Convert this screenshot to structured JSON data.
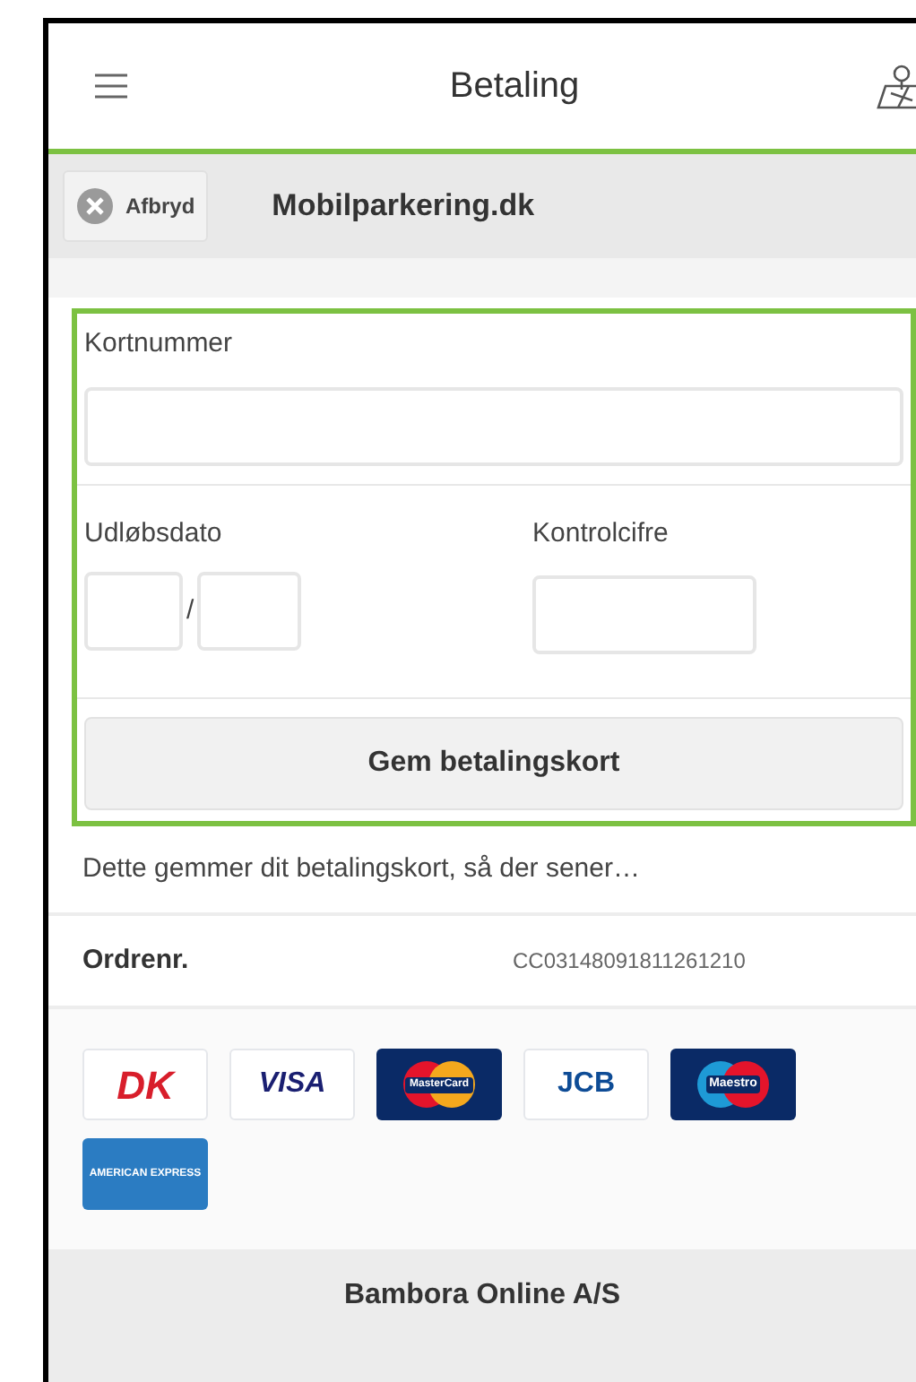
{
  "header": {
    "title": "Betaling"
  },
  "toolbar": {
    "cancel_label": "Afbryd",
    "merchant": "Mobilparkering.dk"
  },
  "form": {
    "card_number": {
      "label": "Kortnummer"
    },
    "expiry": {
      "label": "Udløbsdato",
      "separator": "/"
    },
    "cvc": {
      "label": "Kontrolcifre"
    },
    "submit": "Gem betalingskort"
  },
  "note": "Dette gemmer dit betalingskort, så der sener…",
  "order": {
    "label": "Ordrenr.",
    "value": "CC03148091811261210"
  },
  "cards": [
    {
      "kind": "dankort",
      "label": "DK"
    },
    {
      "kind": "visa",
      "label": "VISA"
    },
    {
      "kind": "mastercard",
      "label": "MasterCard"
    },
    {
      "kind": "jcb",
      "label": "JCB"
    },
    {
      "kind": "maestro",
      "label": "Maestro"
    },
    {
      "kind": "amex",
      "label": "AMERICAN EXPRESS"
    }
  ],
  "footer": "Bambora Online A/S"
}
